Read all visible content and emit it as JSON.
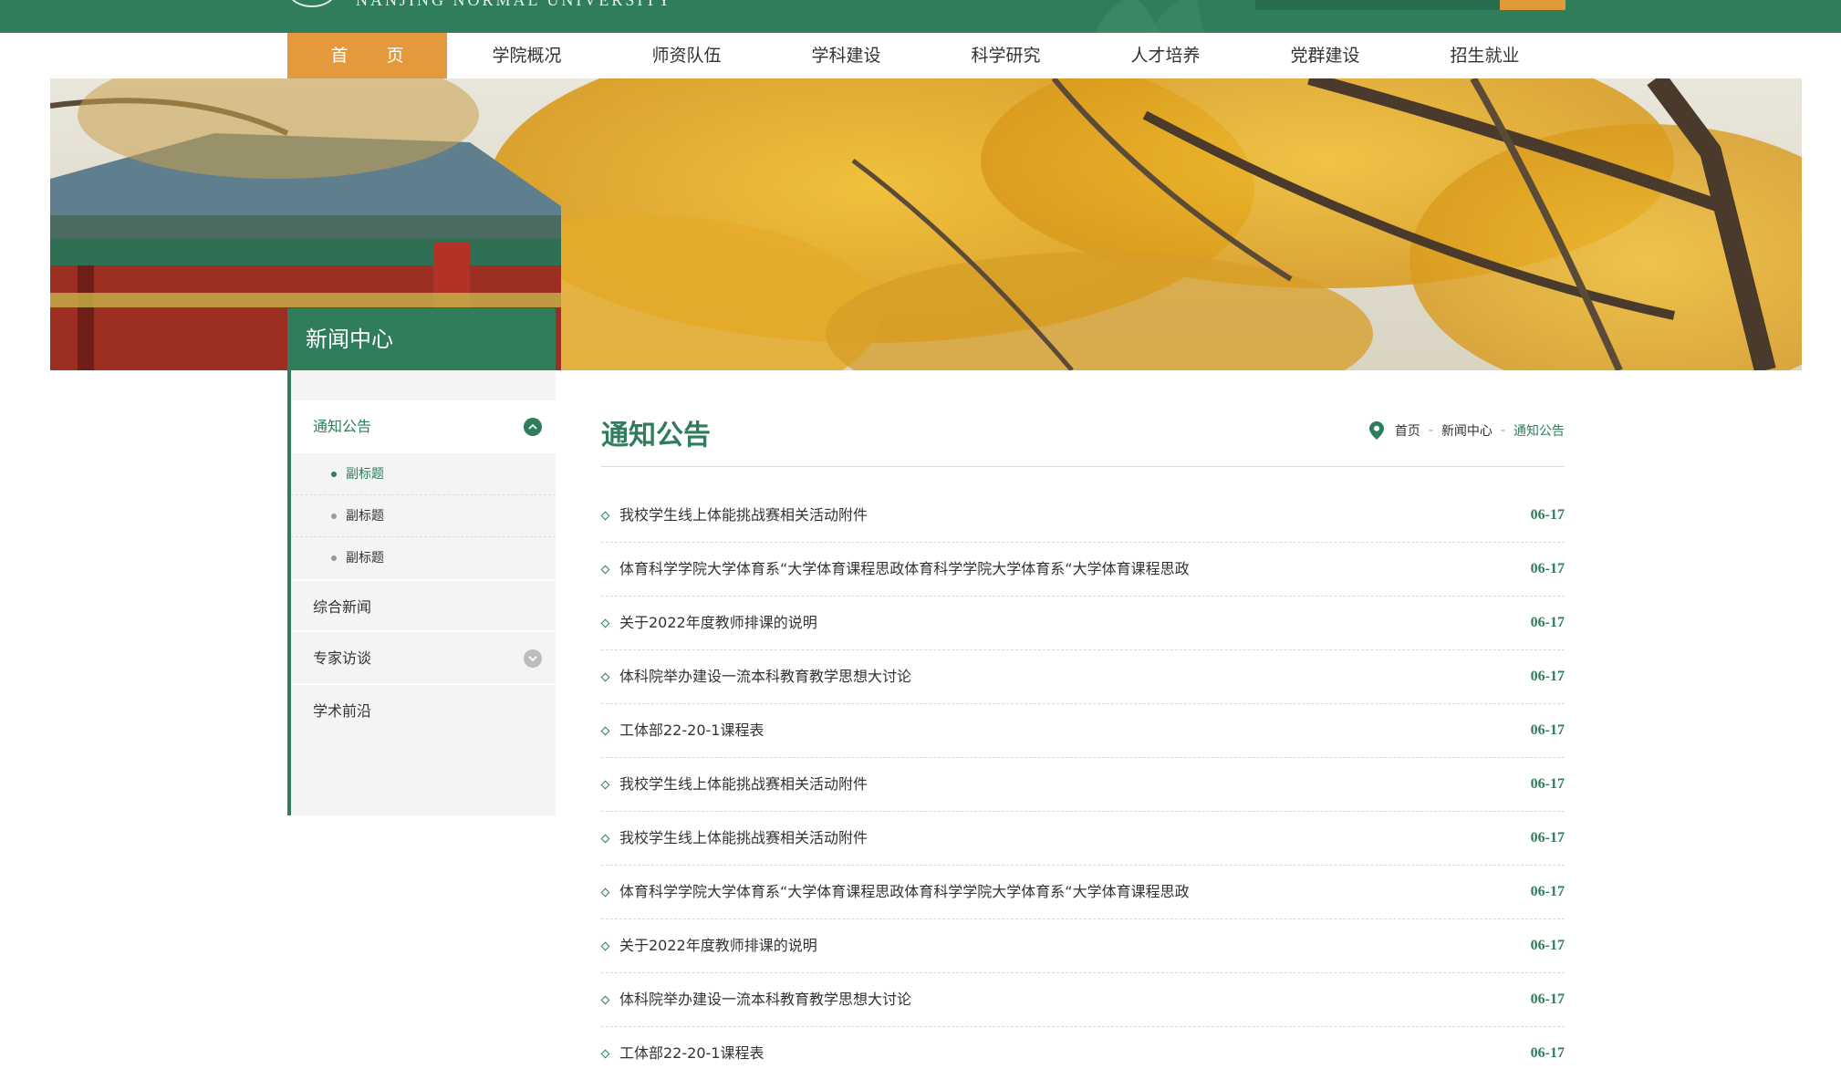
{
  "colors": {
    "brand": "#2f7d5a",
    "accent": "#e3993c"
  },
  "header": {
    "logo_text": "NANJING NORMAL UNIVERSITY",
    "search_icon": "search-icon"
  },
  "nav": {
    "items": [
      {
        "label": "首 页",
        "active": true
      },
      {
        "label": "学院概况"
      },
      {
        "label": "师资队伍"
      },
      {
        "label": "学科建设"
      },
      {
        "label": "科学研究"
      },
      {
        "label": "人才培养"
      },
      {
        "label": "党群建设"
      },
      {
        "label": "招生就业"
      }
    ]
  },
  "sidebar": {
    "title": "新闻中心",
    "items": [
      {
        "label": "通知公告",
        "toggle_icon": "chevron-up-icon"
      },
      {
        "label": "综合新闻"
      },
      {
        "label": "专家访谈",
        "toggle_icon": "chevron-down-icon"
      },
      {
        "label": "学术前沿"
      }
    ],
    "subitems": [
      {
        "label": "副标题"
      },
      {
        "label": "副标题"
      },
      {
        "label": "副标题"
      }
    ]
  },
  "main": {
    "title": "通知公告",
    "breadcrumb": {
      "icon": "location-pin-icon",
      "home": "首页",
      "sep": "-",
      "section": "新闻中心",
      "current": "通知公告"
    },
    "news": [
      {
        "title": "我校学生线上体能挑战赛相关活动附件",
        "date": "06-17"
      },
      {
        "title": "体育科学学院大学体育系“大学体育课程思政体育科学学院大学体育系“大学体育课程思政",
        "date": "06-17"
      },
      {
        "title": "关于2022年度教师排课的说明",
        "date": "06-17"
      },
      {
        "title": "体科院举办建设一流本科教育教学思想大讨论",
        "date": "06-17"
      },
      {
        "title": "工体部22-20-1课程表",
        "date": "06-17"
      },
      {
        "title": "我校学生线上体能挑战赛相关活动附件",
        "date": "06-17"
      },
      {
        "title": "我校学生线上体能挑战赛相关活动附件",
        "date": "06-17"
      },
      {
        "title": "体育科学学院大学体育系“大学体育课程思政体育科学学院大学体育系“大学体育课程思政",
        "date": "06-17"
      },
      {
        "title": "关于2022年度教师排课的说明",
        "date": "06-17"
      },
      {
        "title": "体科院举办建设一流本科教育教学思想大讨论",
        "date": "06-17"
      },
      {
        "title": "工体部22-20-1课程表",
        "date": "06-17"
      }
    ]
  }
}
